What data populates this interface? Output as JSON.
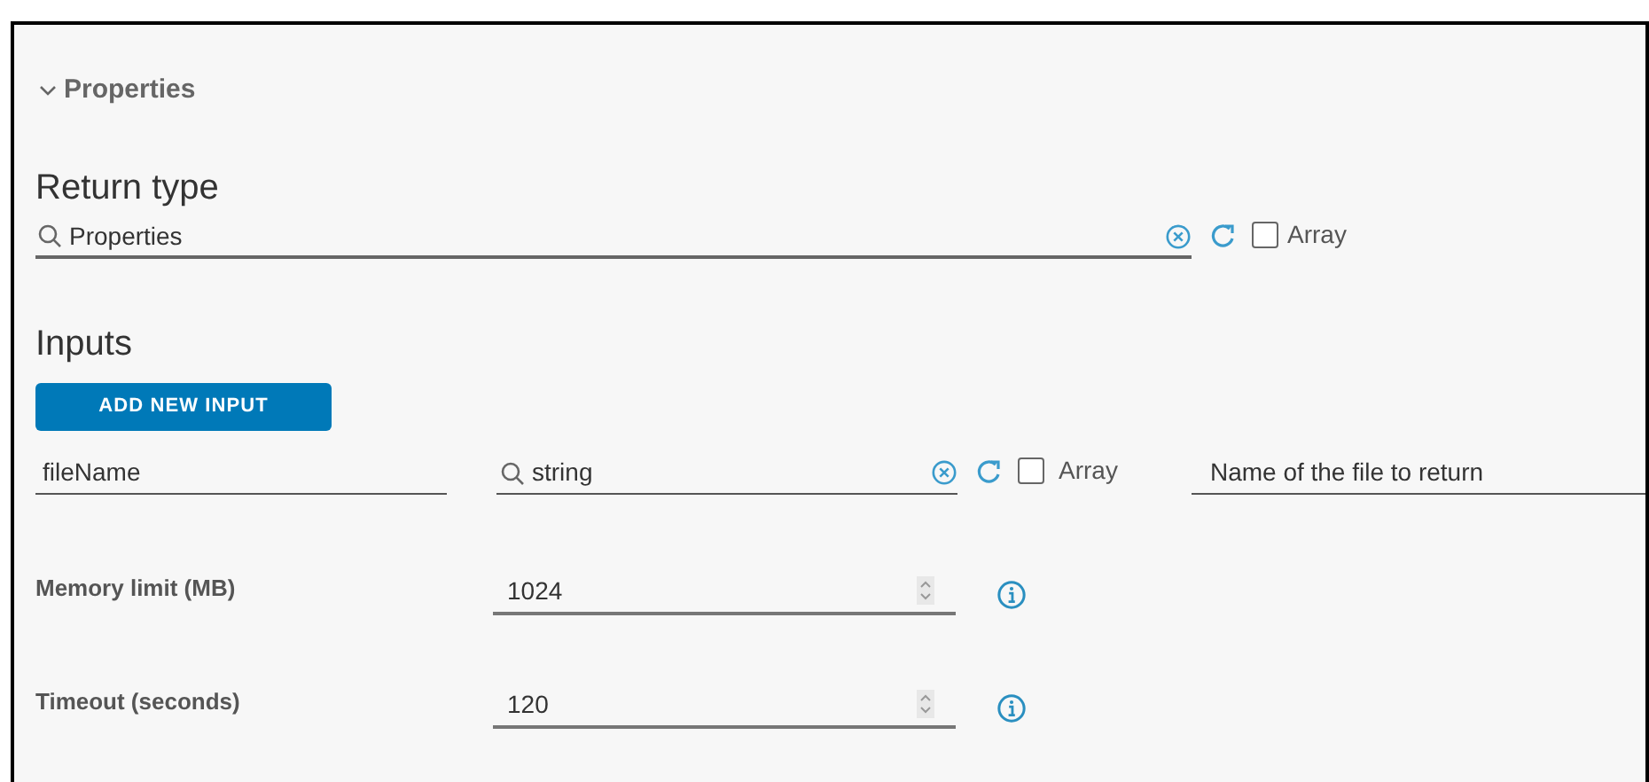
{
  "section": {
    "title": "Properties",
    "expanded": true
  },
  "return_type": {
    "label": "Return type",
    "search": {
      "value": "Properties"
    },
    "array": {
      "label": "Array",
      "checked": false
    }
  },
  "inputs": {
    "label": "Inputs",
    "add_button": "ADD NEW INPUT",
    "rows": [
      {
        "name": "fileName",
        "type": "string",
        "array": {
          "label": "Array",
          "checked": false
        },
        "description": "Name of the file to return"
      }
    ]
  },
  "settings": [
    {
      "label": "Memory limit (MB)",
      "value": "1024"
    },
    {
      "label": "Timeout (seconds)",
      "value": "120"
    }
  ]
}
